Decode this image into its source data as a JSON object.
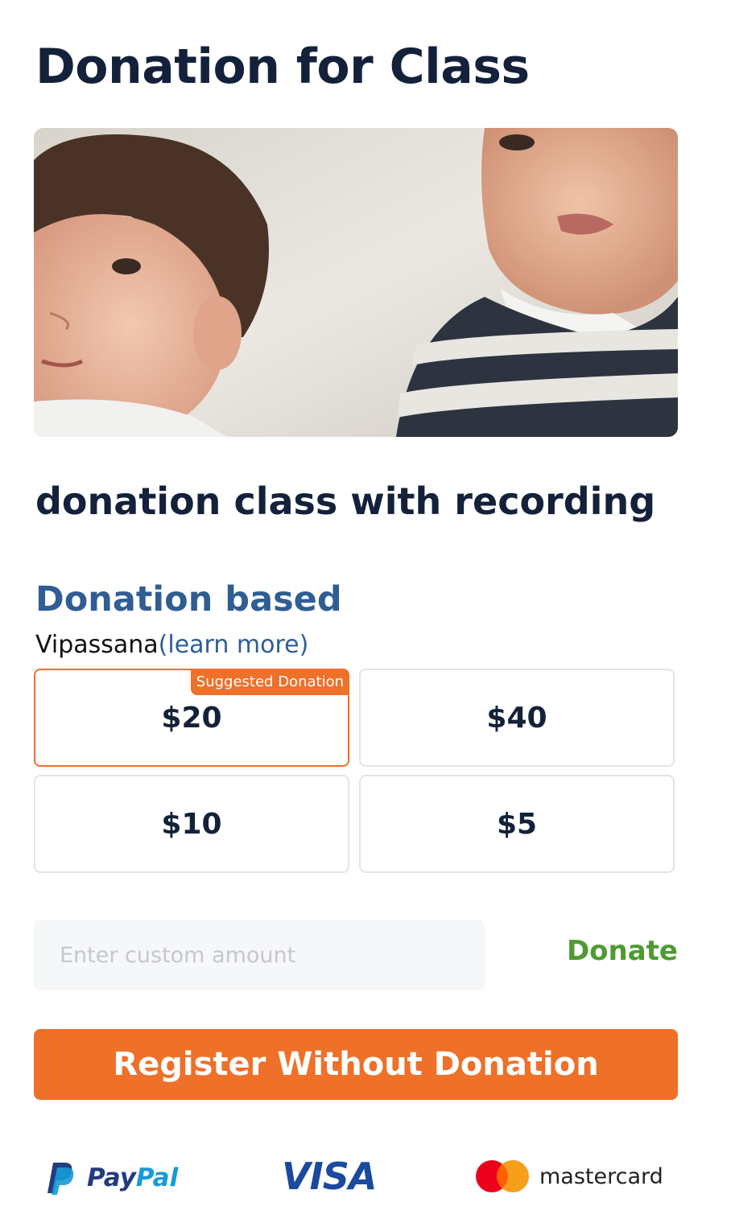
{
  "page": {
    "title": "Donation for Class"
  },
  "class": {
    "name": "donation class with recording"
  },
  "pricing": {
    "type_label": "Donation based",
    "style_name": "Vipassana",
    "learn_more_label": "(learn more)",
    "suggested_tag": "Suggested Donation",
    "amounts": [
      {
        "label": "$20",
        "suggested": true
      },
      {
        "label": "$40",
        "suggested": false
      },
      {
        "label": "$10",
        "suggested": false
      },
      {
        "label": "$5",
        "suggested": false
      }
    ]
  },
  "custom_amount": {
    "placeholder": "Enter custom amount",
    "value": ""
  },
  "actions": {
    "donate_label": "Donate",
    "register_label": "Register Without Donation"
  },
  "payment_logos": {
    "paypal_pay": "Pay",
    "paypal_pal": "Pal",
    "visa": "VISA",
    "mastercard": "mastercard"
  },
  "colors": {
    "primary_text": "#14213a",
    "accent_blue": "#2f5d94",
    "accent_orange": "#ee7029",
    "donate_green": "#4f9a32"
  }
}
